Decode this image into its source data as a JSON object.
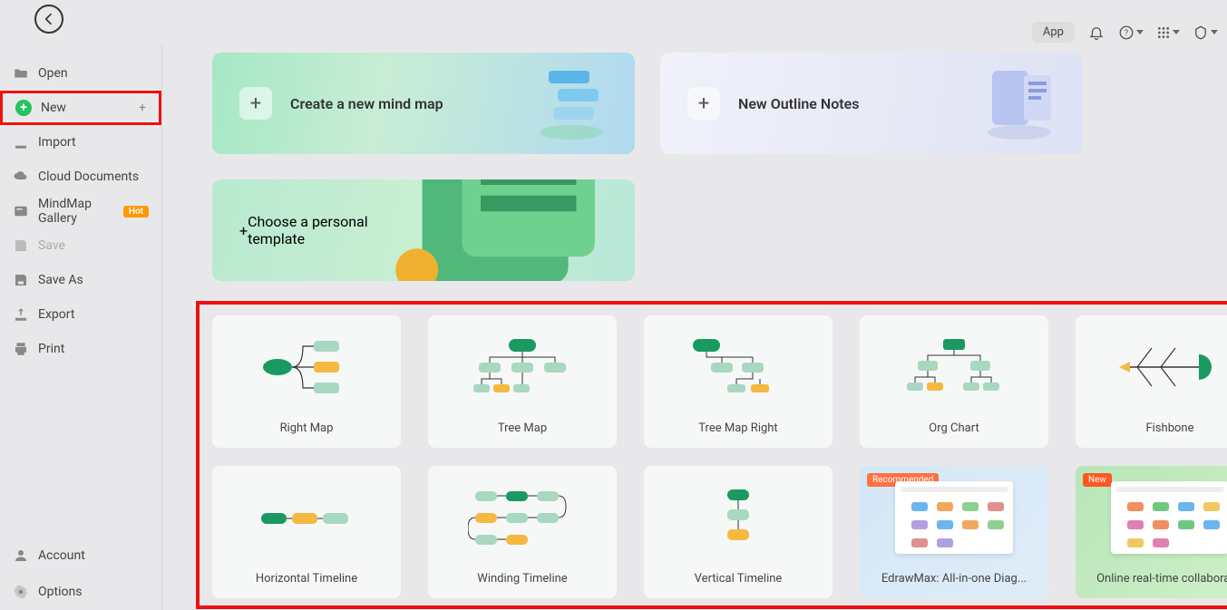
{
  "sidebar": {
    "open": "Open",
    "new": "New",
    "import": "Import",
    "cloud": "Cloud Documents",
    "gallery": "MindMap Gallery",
    "hot": "Hot",
    "save": "Save",
    "saveAs": "Save As",
    "export": "Export",
    "print": "Print",
    "account": "Account",
    "options": "Options"
  },
  "topbar": {
    "app": "App"
  },
  "cards": {
    "createMindMap": "Create a new mind map",
    "outlineNotes": "New Outline Notes",
    "personalTemplate": "Choose a personal template"
  },
  "templates": [
    {
      "label": "Right Map"
    },
    {
      "label": "Tree Map"
    },
    {
      "label": "Tree Map Right"
    },
    {
      "label": "Org Chart"
    },
    {
      "label": "Fishbone"
    },
    {
      "label": "Horizontal Timeline"
    },
    {
      "label": "Winding Timeline"
    },
    {
      "label": "Vertical Timeline"
    },
    {
      "label": "EdrawMax: All-in-one Diag...",
      "tag": "Recommended",
      "tagClass": "rec",
      "special": "edmax"
    },
    {
      "label": "Online real-time collaborat...",
      "tag": "New",
      "tagClass": "new",
      "special": "ort"
    }
  ]
}
